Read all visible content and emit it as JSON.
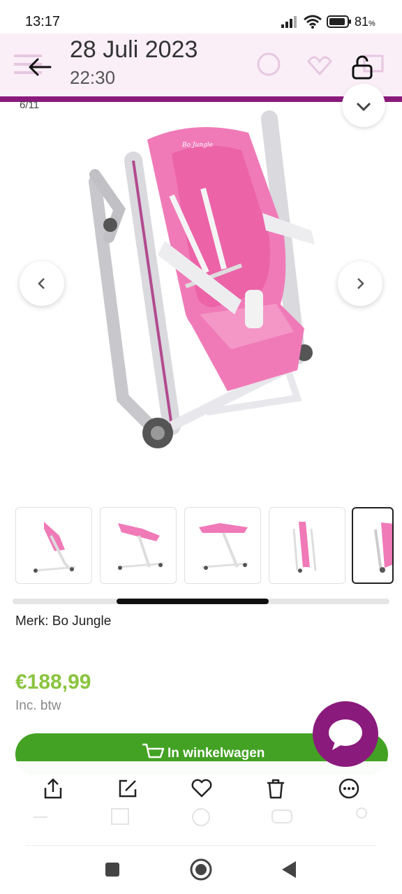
{
  "status_bar": {
    "time": "13:17",
    "battery_percent": "81",
    "battery_suffix": "%"
  },
  "header": {
    "date": "28 Juli 2023",
    "time": "22:30"
  },
  "gallery": {
    "counter": "6/11",
    "thumbnail_count": 5,
    "active_thumbnail": 5
  },
  "product": {
    "brand_line": "Merk: Bo Jungle",
    "price": "€188,99",
    "vat_note": "Inc. btw",
    "cart_button_label": "In winkelwagen"
  },
  "toolbar": {
    "items": [
      "share-icon",
      "edit-icon",
      "heart-icon",
      "trash-icon",
      "more-icon"
    ]
  },
  "colors": {
    "brand_purple": "#8a1a7c",
    "price_green": "#8ac43f",
    "cart_green": "#43a223",
    "chair_pink": "#f06ab0"
  }
}
